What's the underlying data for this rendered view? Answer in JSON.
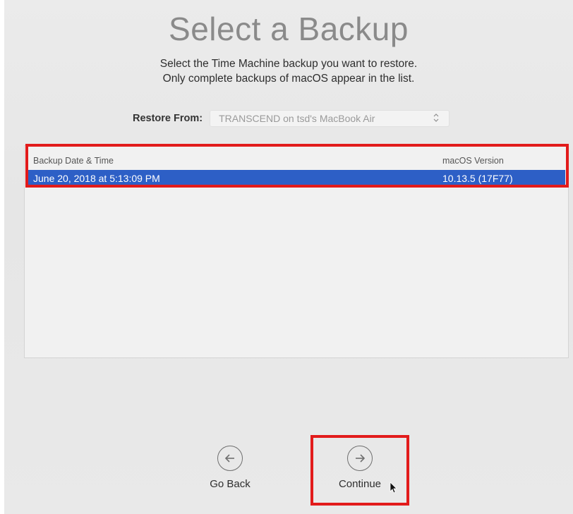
{
  "page": {
    "title": "Select a Backup",
    "subtitle_line1": "Select the Time Machine backup you want to restore.",
    "subtitle_line2": "Only complete backups of macOS appear in the list."
  },
  "restore": {
    "label": "Restore From:",
    "selected": "TRANSCEND on tsd's MacBook Air",
    "icon": "chevron-updown-icon"
  },
  "table": {
    "columns": [
      "Backup Date & Time",
      "macOS Version"
    ],
    "rows": [
      {
        "date": "June 20, 2018 at 5:13:09 PM",
        "version": "10.13.5 (17F77)",
        "selected": true
      }
    ]
  },
  "nav": {
    "back_label": "Go Back",
    "back_icon": "arrow-left-circle-icon",
    "continue_label": "Continue",
    "continue_icon": "arrow-right-circle-icon"
  },
  "colors": {
    "selection": "#2d5fc6",
    "highlight": "#e21b1b",
    "background": "#e9e9e9"
  }
}
